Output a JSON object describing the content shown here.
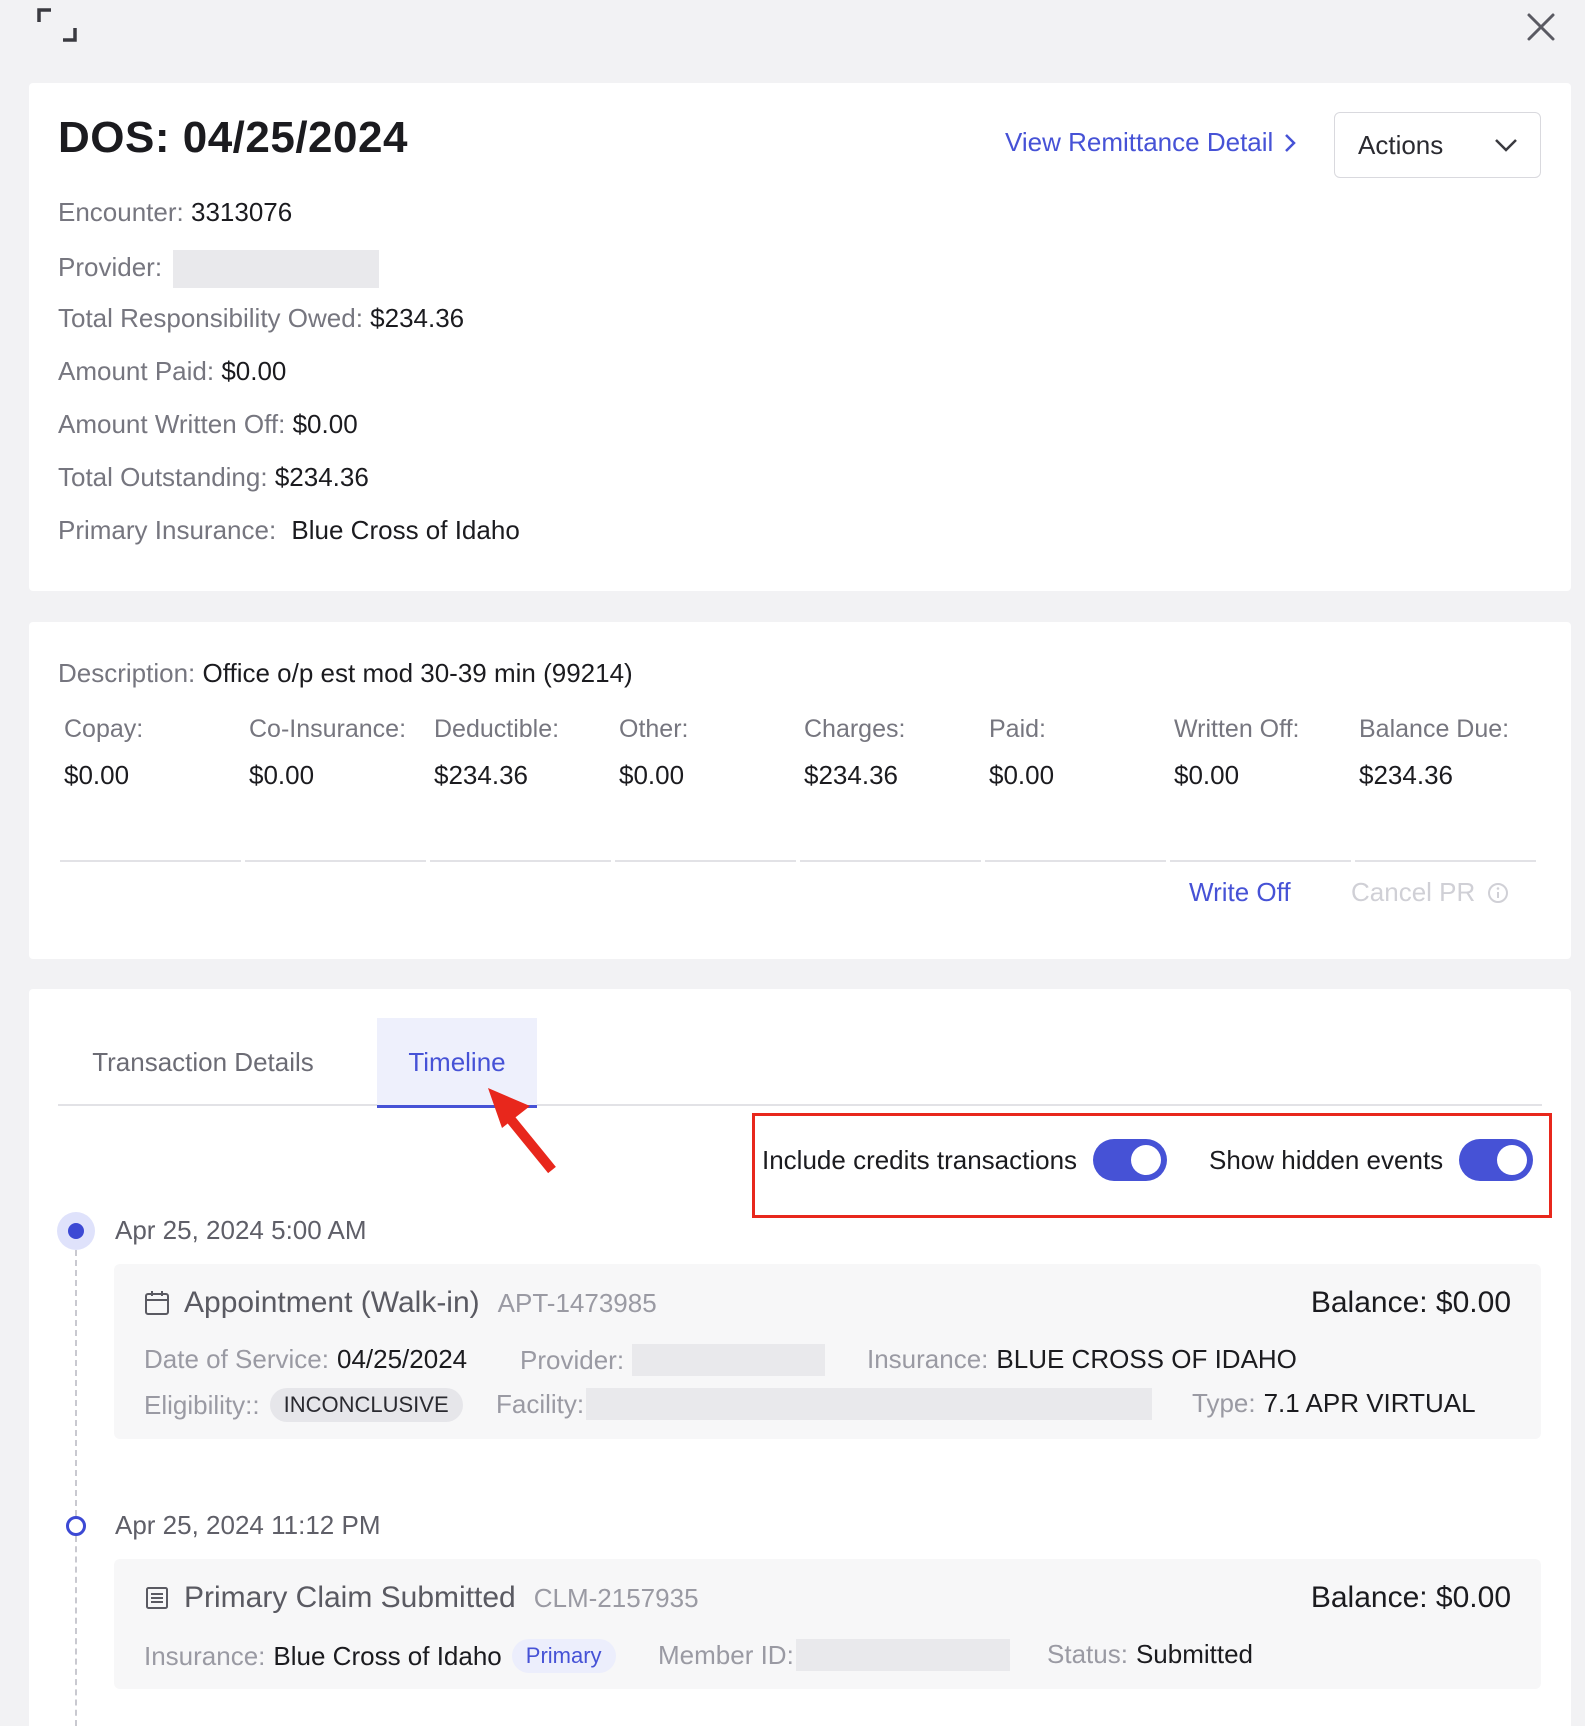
{
  "header": {
    "expand_icon": "expand-icon",
    "close_icon": "close-icon"
  },
  "summary": {
    "title": "DOS: 04/25/2024",
    "remit_link": "View Remittance Detail",
    "actions_label": "Actions",
    "rows": [
      {
        "label": "Encounter:",
        "value": "3313076"
      },
      {
        "label": "Provider:",
        "value": ""
      },
      {
        "label": "Total Responsibility Owed:",
        "value": "$234.36"
      },
      {
        "label": "Amount Paid:",
        "value": "$0.00"
      },
      {
        "label": "Amount Written Off:",
        "value": "$0.00"
      },
      {
        "label": "Total Outstanding:",
        "value": "$234.36"
      },
      {
        "label": "Primary Insurance:",
        "value": "Blue Cross of Idaho"
      }
    ]
  },
  "charge": {
    "description_label": "Description:",
    "description_value": "Office o/p est mod 30-39 min (99214)",
    "columns": [
      {
        "label": "Copay:",
        "value": "$0.00"
      },
      {
        "label": "Co-Insurance:",
        "value": "$0.00"
      },
      {
        "label": "Deductible:",
        "value": "$234.36"
      },
      {
        "label": "Other:",
        "value": "$0.00"
      },
      {
        "label": "Charges:",
        "value": "$234.36"
      },
      {
        "label": "Paid:",
        "value": "$0.00"
      },
      {
        "label": "Written Off:",
        "value": "$0.00"
      },
      {
        "label": "Balance Due:",
        "value": "$234.36"
      }
    ],
    "write_off": "Write Off",
    "cancel_pr": "Cancel PR"
  },
  "tabs": [
    {
      "label": "Transaction Details",
      "active": false
    },
    {
      "label": "Timeline",
      "active": true
    }
  ],
  "toggles": [
    {
      "label": "Include credits transactions",
      "on": true
    },
    {
      "label": "Show hidden events",
      "on": true
    }
  ],
  "timeline": [
    {
      "date": "Apr 25, 2024 5:00 AM",
      "title": "Appointment (Walk-in)",
      "id": "APT-1473985",
      "balance": "Balance: $0.00",
      "dos_label": "Date of Service:",
      "dos_value": "04/25/2024",
      "provider_label": "Provider:",
      "insurance_label": "Insurance:",
      "insurance_value": "BLUE CROSS OF IDAHO",
      "eligibility_label": "Eligibility::",
      "eligibility_value": "INCONCLUSIVE",
      "facility_label": "Facility:",
      "type_label": "Type:",
      "type_value": "7.1 APR VIRTUAL"
    },
    {
      "date": "Apr 25, 2024 11:12 PM",
      "title": "Primary Claim Submitted",
      "id": "CLM-2157935",
      "balance": "Balance: $0.00",
      "insurance_label": "Insurance:",
      "insurance_value": "Blue Cross of Idaho",
      "insurance_tag": "Primary",
      "member_label": "Member ID:",
      "status_label": "Status:",
      "status_value": "Submitted"
    }
  ],
  "colors": {
    "accent": "#4652d6",
    "highlight": "#e8271c"
  }
}
